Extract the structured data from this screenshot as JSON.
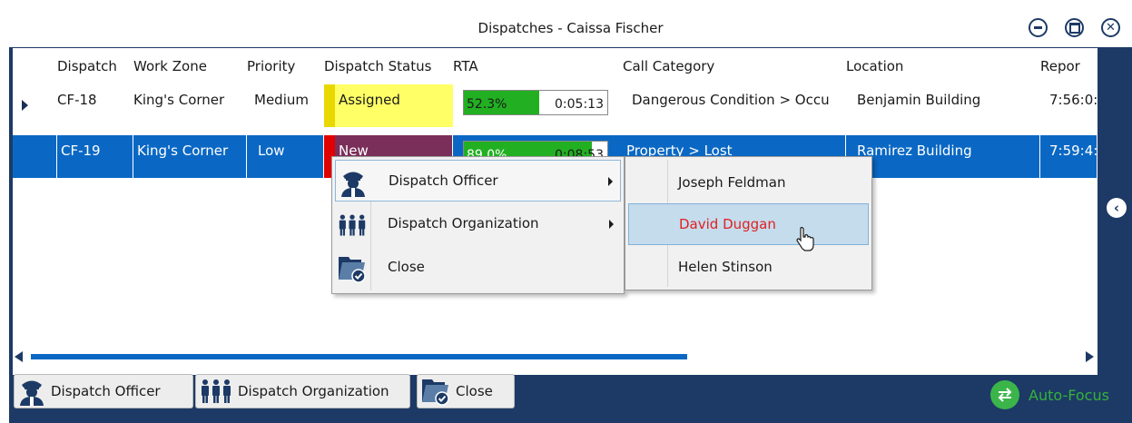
{
  "window": {
    "title": "Dispatches - Caissa Fischer",
    "controls": [
      "minimize-icon",
      "maximize-icon",
      "close-icon"
    ]
  },
  "grid": {
    "columns": [
      "Dispatch",
      "Work Zone",
      "Priority",
      "Dispatch Status",
      "RTA",
      "Call Category",
      "Location",
      "Repor"
    ],
    "rows": [
      {
        "dispatch": "CF-18",
        "work_zone": "King's Corner",
        "priority": "Medium",
        "status": "Assigned",
        "status_color": "#ffff66",
        "status_bar_color": "#e8d800",
        "rta_pct": "52.3%",
        "rta_fraction": 0.523,
        "rta_time": "0:05:13",
        "call_category": "Dangerous Condition > Occu",
        "location": "Benjamin Building",
        "reported": "7:56:0:",
        "current": true,
        "selected": false
      },
      {
        "dispatch": "CF-19",
        "work_zone": "King's Corner",
        "priority": "Low",
        "status": "New",
        "status_color": "#7a2e5a",
        "status_bar_color": "#e00000",
        "rta_pct": "89.0%",
        "rta_fraction": 0.89,
        "rta_time": "0:08:53",
        "call_category": "Property > Lost",
        "location": "Ramirez Building",
        "reported": "7:59:4:",
        "current": false,
        "selected": true
      }
    ]
  },
  "context_menu": {
    "items": [
      {
        "label": "Dispatch Officer",
        "icon": "officer-icon",
        "has_submenu": true
      },
      {
        "label": "Dispatch Organization",
        "icon": "organization-icon",
        "has_submenu": true
      },
      {
        "label": "Close",
        "icon": "close-folder-icon",
        "has_submenu": false
      }
    ]
  },
  "submenu": {
    "items": [
      {
        "label": "Joseph Feldman",
        "highlighted": false
      },
      {
        "label": "David Duggan",
        "highlighted": true
      },
      {
        "label": "Helen Stinson",
        "highlighted": false
      }
    ]
  },
  "toolbar": {
    "dispatch_officer": "Dispatch Officer",
    "dispatch_organization": "Dispatch Organization",
    "close": "Close",
    "auto_focus": "Auto-Focus"
  },
  "colors": {
    "frame": "#1d3a66",
    "selection": "#0a68c4",
    "rta_fill": "#22b022",
    "auto_focus": "#3bb54a",
    "highlight_text": "#e02020"
  }
}
